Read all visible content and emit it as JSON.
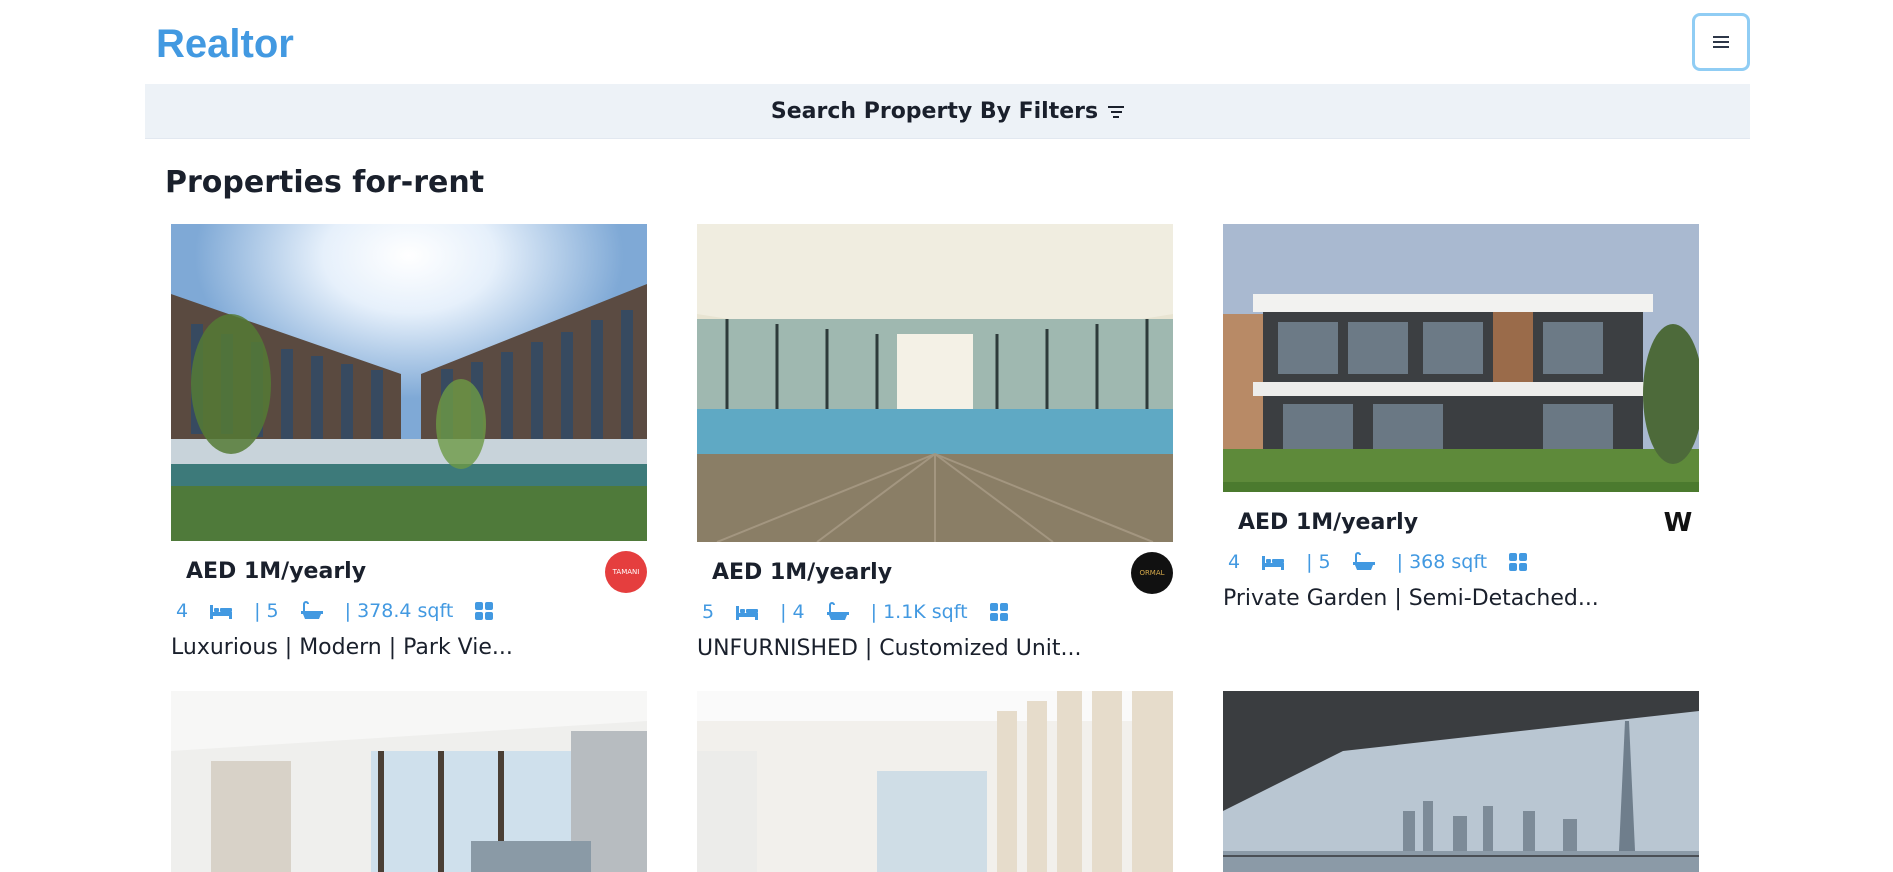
{
  "header": {
    "logo": "Realtor",
    "menu_icon": "hamburger-icon"
  },
  "filter_bar": {
    "label": "Search Property By Filters",
    "icon": "filter-icon"
  },
  "section_title": "Properties for-rent",
  "properties": [
    {
      "price": "AED 1M/yearly",
      "rooms": "4",
      "baths": "| 5",
      "area": "| 378.4 sqft",
      "description": "Luxurious | Modern | Park Vie...",
      "agency_logo_text": "TAMANI",
      "agency_color": "#e53e3e"
    },
    {
      "price": "AED 1M/yearly",
      "rooms": "5",
      "baths": "| 4",
      "area": "| 1.1K sqft",
      "description": "UNFURNISHED | Customized Unit...",
      "agency_logo_text": "ORMAL",
      "agency_color": "#111111"
    },
    {
      "price": "AED 1M/yearly",
      "rooms": "4",
      "baths": "| 5",
      "area": "| 368 sqft",
      "description": "Private Garden | Semi-Detached...",
      "agency_logo_text": "W",
      "agency_color": "#ffffff"
    }
  ],
  "colors": {
    "accent": "#4299e1",
    "filter_bg": "#edf2f7",
    "menu_border": "#90cdf4"
  }
}
